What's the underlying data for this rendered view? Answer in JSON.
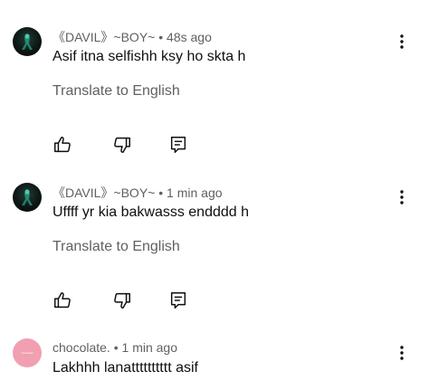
{
  "comments": [
    {
      "author": "《DAVIL》~BOY~",
      "separator": "•",
      "time": "48s ago",
      "text": "Asif itna selfishh ksy ho skta h",
      "translate": "Translate to English",
      "avatar_icon": "dark-avatar-icon"
    },
    {
      "author": "《DAVIL》~BOY~",
      "separator": "•",
      "time": "1 min ago",
      "text": "Uffff yr kia bakwasss endddd h",
      "translate": "Translate to English",
      "avatar_icon": "dark-avatar-icon"
    },
    {
      "author": "chocolate.",
      "separator": "•",
      "time": "1 min ago",
      "text": "Lakhhh lanatttttttttt asif",
      "avatar_label": "chocolate",
      "avatar_color": "#f0a0b0"
    }
  ],
  "icons": {
    "like": "thumbs-up-icon",
    "dislike": "thumbs-down-icon",
    "reply": "reply-icon",
    "more": "more-vert-icon"
  }
}
